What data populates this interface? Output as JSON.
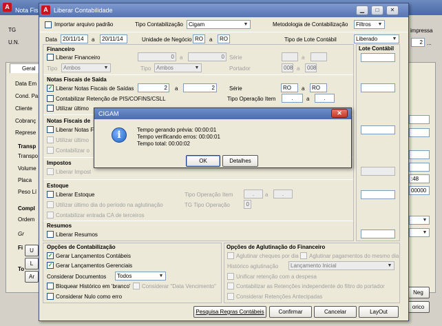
{
  "bg": {
    "title": "Nota Fis",
    "tg": "TG",
    "un": "U.N.",
    "impressa": "impressa",
    "val2": "2",
    "tab": "Geral",
    "left": [
      "Data Em",
      "Cond. Pa",
      "Cliente",
      "Cobranç",
      "Represe"
    ],
    "transp": "Transp",
    "transp_items": [
      "Transpo",
      "Volume",
      "Placa",
      "Peso Lí"
    ],
    "compl": "Compl",
    "ordem": "Ordem",
    "right_vals": [
      ":48",
      "00000"
    ],
    "neg": "Neg",
    "orico": "orico",
    "side_letters": [
      "U",
      "L",
      "Ar"
    ],
    "fi": "Fi",
    "to": "To",
    "ge": "Gr"
  },
  "dlg": {
    "title": "Liberar Contabilidade",
    "importar": "Importar arquivo padrão",
    "tipo_contab": "Tipo Contabilização",
    "tipo_contab_val": "Cigam",
    "metodologia": "Metodologia de Contabilização",
    "metodologia_val": "Filtros",
    "data": "Data",
    "data_ini": "20/11/14",
    "a": "a",
    "data_fim": "20/11/14",
    "unidade": "Unidade de Negócio",
    "un_ini": "RO",
    "un_fim": "RO",
    "tipo_lote": "Tipo de Lote Contábil",
    "tipo_lote_val": "Liberado",
    "lote_contabil": "Lote Contábil",
    "financeiro": {
      "title": "Financeiro",
      "liberar": "Liberar Financeiro",
      "v1": "0",
      "v2": "0",
      "serie": "Série",
      "tipo": "Tipo",
      "tipo_val": "Ambos",
      "tipo2": "Tipo",
      "tipo2_val": "Ambos",
      "portador": "Portador",
      "p1": "008",
      "p2": "008"
    },
    "nf_saida": {
      "title": "Notas Fiscais de Saída",
      "liberar": "Liberar Notas Fiscais de Saídas",
      "v1": "2",
      "v2": "2",
      "serie": "Série",
      "s1": "RO",
      "s2": "RO",
      "pis": "Contabilizar Retenção de PIS/COFINS/CSLL",
      "tipo_op": "Tipo Operação Item",
      "t1": ".",
      "t2": ".",
      "utilizar": "Utilizar último"
    },
    "nf_ent": {
      "title": "Notas Fiscais de",
      "liberar": "Liberar Notas F",
      "utilizar": "Utilizar último",
      "contab": "Contabilizar o"
    },
    "impostos": {
      "title": "Impostos",
      "liberar": "Liberar Impost"
    },
    "estoque": {
      "title": "Estoque",
      "liberar": "Liberar Estoque",
      "tipo_op": "Tipo Operação Item",
      "t1": ".",
      "t2": ".",
      "utilizar": "Utilizar último dia do período na aglutinação",
      "tg_tipo": "TG Tipo Operação",
      "tg_val": "0",
      "contab_ca": "Contabilizar entrada CA de terceiros"
    },
    "resumos": {
      "title": "Resumos",
      "liberar": "Liberar Resumos"
    },
    "opcoes": {
      "title": "Opções de Contabilização",
      "gerar_contab": "Gerar Lançamentos Contábeis",
      "gerar_ger": "Gerar Lançamentos Gerenciais",
      "considerar_docs": "Considerar Documentos",
      "docs_val": "Todos",
      "bloquear": "Bloquear Histórico em 'branco'",
      "venc": "Considerar \"Data Vencimento\"",
      "nulo": "Considerar Nulo como erro"
    },
    "aglut": {
      "title": "Opções de Aglutinação do Financeiro",
      "cheques": "Aglutinar cheques por dia",
      "pagtos": "Aglutinar pagamentos do mesmo dia",
      "historico": "Histórico aglutinação",
      "historico_val": "Lançamento Inicial",
      "unificar": "Unificar retenção com a despesa",
      "contab_ret": "Contabilizar as Retenções independente do filtro do portador",
      "antecipadas": "Considerar Retenções Antecipadas"
    },
    "buttons": {
      "pesquisa": "Pesquisa Regras Contábeis",
      "confirmar": "Confirmar",
      "cancelar": "Cancelar",
      "layout": "LayOut"
    }
  },
  "msg": {
    "title": "CIGAM",
    "line1": "Tempo gerando prévia: 00:00:01",
    "line2": "Tempo verificando erros: 00:00:01",
    "line3": "Tempo total: 00:00:02",
    "ok": "OK",
    "detalhes": "Detalhes"
  },
  "colors": {
    "titlebar": "#4a69a6",
    "cigam_red": "#c8141e",
    "info_blue": "#2064c0"
  }
}
